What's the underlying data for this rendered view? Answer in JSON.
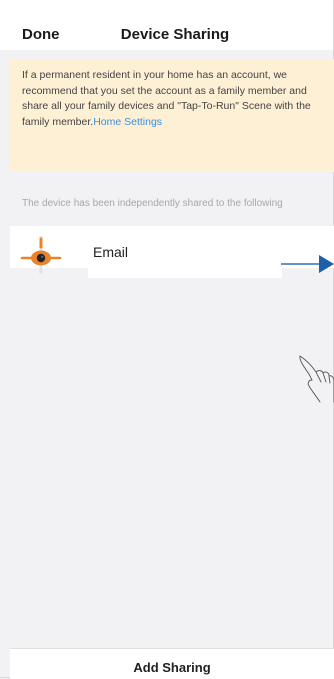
{
  "header": {
    "done_label": "Done",
    "title": "Device Sharing"
  },
  "notice": {
    "text": "If a permanent resident in your home has an account, we recommend that you set the account as a family member and share all your family devices and \"Tap-To-Run\" Scene with the family member.",
    "link": "Home Settings",
    "background": "#fdf0d5",
    "link_color": "#3c8fe0"
  },
  "shared": {
    "caption": "The device has been independently shared to the following",
    "items": [
      {
        "label": "Email",
        "icon": "camera-device-icon"
      }
    ]
  },
  "annotations": {
    "arrow": "arrow-icon",
    "hand": "tap-hand-icon"
  },
  "footer": {
    "add_label": "Add Sharing"
  }
}
